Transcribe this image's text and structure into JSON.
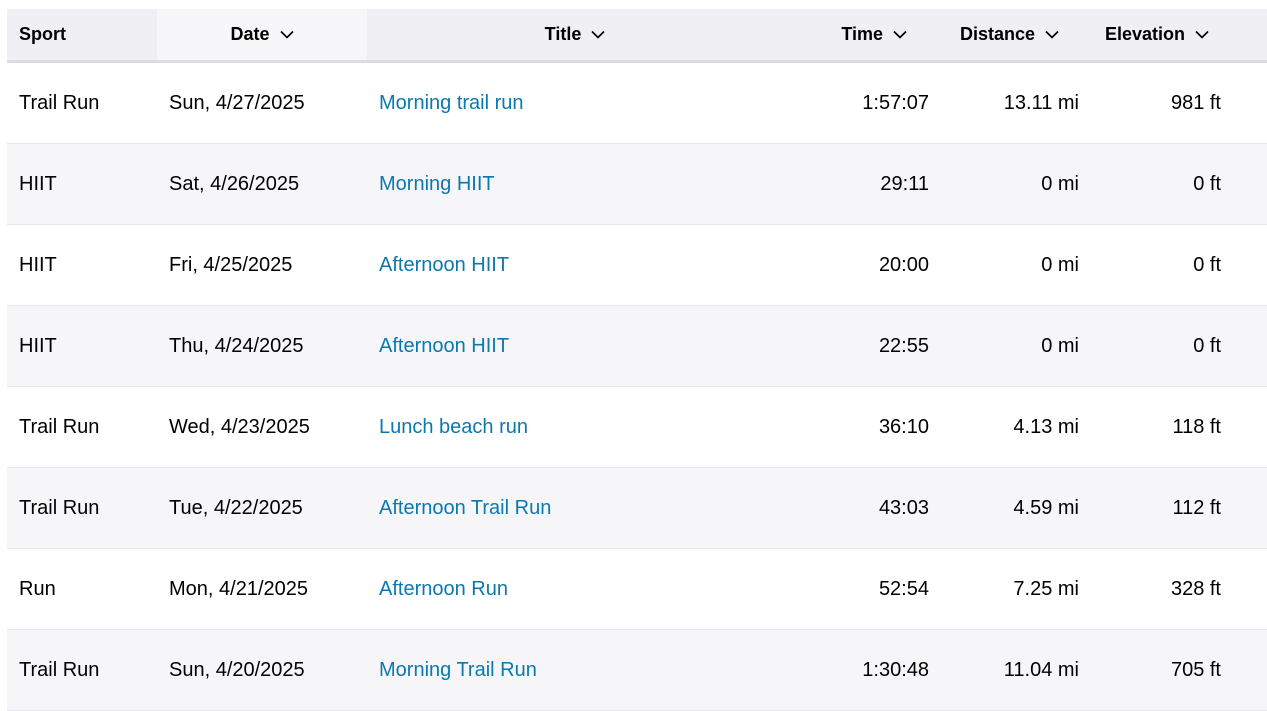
{
  "columns": {
    "sport": "Sport",
    "date": "Date",
    "title": "Title",
    "time": "Time",
    "distance": "Distance",
    "elevation": "Elevation"
  },
  "icons": {
    "sort": "chevron-down-icon"
  },
  "colors": {
    "link": "#0b78b0",
    "header_bg": "#f0f0f4",
    "row_alt_bg": "#f6f6f8"
  },
  "activities": [
    {
      "sport": "Trail Run",
      "date": "Sun, 4/27/2025",
      "title": "Morning trail run",
      "time": "1:57:07",
      "distance": "13.11 mi",
      "elevation": "981 ft"
    },
    {
      "sport": "HIIT",
      "date": "Sat, 4/26/2025",
      "title": "Morning HIIT",
      "time": "29:11",
      "distance": "0 mi",
      "elevation": "0 ft"
    },
    {
      "sport": "HIIT",
      "date": "Fri, 4/25/2025",
      "title": "Afternoon HIIT",
      "time": "20:00",
      "distance": "0 mi",
      "elevation": "0 ft"
    },
    {
      "sport": "HIIT",
      "date": "Thu, 4/24/2025",
      "title": "Afternoon HIIT",
      "time": "22:55",
      "distance": "0 mi",
      "elevation": "0 ft"
    },
    {
      "sport": "Trail Run",
      "date": "Wed, 4/23/2025",
      "title": "Lunch beach run",
      "time": "36:10",
      "distance": "4.13 mi",
      "elevation": "118 ft"
    },
    {
      "sport": "Trail Run",
      "date": "Tue, 4/22/2025",
      "title": "Afternoon Trail Run",
      "time": "43:03",
      "distance": "4.59 mi",
      "elevation": "112 ft"
    },
    {
      "sport": "Run",
      "date": "Mon, 4/21/2025",
      "title": "Afternoon Run",
      "time": "52:54",
      "distance": "7.25 mi",
      "elevation": "328 ft"
    },
    {
      "sport": "Trail Run",
      "date": "Sun, 4/20/2025",
      "title": "Morning Trail Run",
      "time": "1:30:48",
      "distance": "11.04 mi",
      "elevation": "705 ft"
    }
  ]
}
